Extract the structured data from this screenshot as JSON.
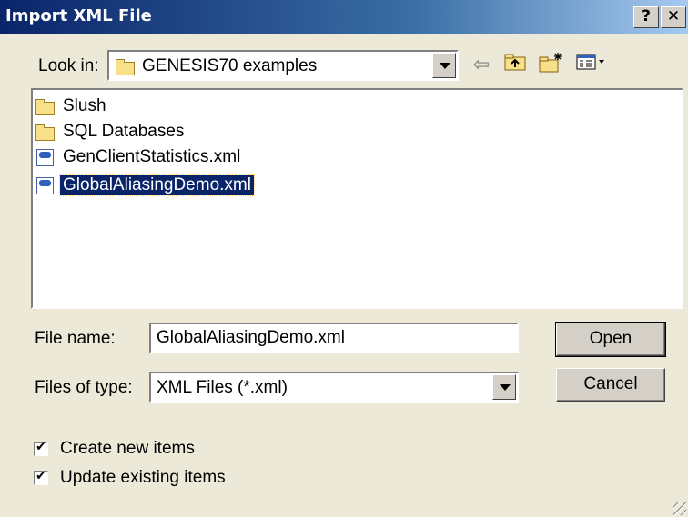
{
  "window": {
    "title": "Import XML File",
    "help_glyph": "?",
    "close_glyph": "✕"
  },
  "look_in": {
    "label": "Look in:",
    "value": "GENESIS70 examples"
  },
  "toolbar": {
    "back_icon": "back-arrow-icon",
    "up_icon": "up-folder-icon",
    "new_folder_icon": "new-folder-icon",
    "view_menu_icon": "view-menu-icon"
  },
  "files": [
    {
      "name": "Slush",
      "type": "folder"
    },
    {
      "name": "SQL Databases",
      "type": "folder"
    },
    {
      "name": "GenClientStatistics.xml",
      "type": "xml"
    },
    {
      "name": "GlobalAliasingDemo.xml",
      "type": "xml",
      "selected": true
    }
  ],
  "file_name": {
    "label": "File name:",
    "value": "GlobalAliasingDemo.xml"
  },
  "file_type": {
    "label": "Files of type:",
    "value": "XML Files (*.xml)"
  },
  "buttons": {
    "open": "Open",
    "cancel": "Cancel"
  },
  "options": {
    "create_new": {
      "label": "Create new items",
      "checked": true
    },
    "update_existing": {
      "label": "Update existing items",
      "checked": true
    }
  },
  "colors": {
    "titlebar_start": "#0a246a",
    "titlebar_end": "#a6caf0",
    "dialog_bg": "#ece9d8",
    "selection": "#0a246a"
  }
}
